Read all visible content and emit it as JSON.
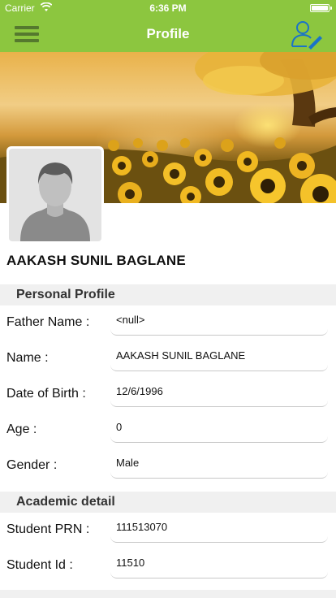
{
  "status_bar": {
    "carrier": "Carrier",
    "time": "6:36 PM",
    "battery_level": 1.0
  },
  "nav": {
    "title": "Profile",
    "menu_icon": "hamburger-menu-icon",
    "edit_icon": "user-edit-icon"
  },
  "colors": {
    "accent": "#8cc63f",
    "section_bg": "#f0f0f0",
    "field_line": "#c8c8c8"
  },
  "profile": {
    "name": "AAKASH SUNIL BAGLANE"
  },
  "personal_profile": {
    "title": "Personal Profile",
    "fields": [
      {
        "label": "Father Name :",
        "value": "<null>"
      },
      {
        "label": "Name :",
        "value": "AAKASH SUNIL BAGLANE"
      },
      {
        "label": "Date of Birth :",
        "value": "12/6/1996"
      },
      {
        "label": "Age :",
        "value": "0"
      },
      {
        "label": "Gender :",
        "value": "Male"
      }
    ]
  },
  "academic_detail": {
    "title": "Academic detail",
    "fields": [
      {
        "label": "Student PRN :",
        "value": "111513070"
      },
      {
        "label": "Student Id :",
        "value": "11510"
      }
    ]
  }
}
